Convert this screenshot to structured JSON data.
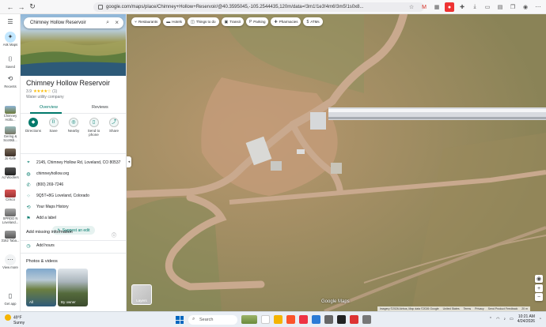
{
  "browser": {
    "url": "google.com/maps/place/Chimney+Hollow+Reservoir/@40.3595045,-105.2544435,120m/data=!3m1!1e3!4m6!3m5!1s0x8..."
  },
  "sidebar": {
    "items": [
      {
        "label": "Ask Maps",
        "icon": "sparkle-icon"
      },
      {
        "label": "Saved",
        "icon": "bookmark-icon"
      },
      {
        "label": "Recents",
        "icon": "history-icon"
      },
      {
        "label": "Chimney Hollo...",
        "icon": "place-thumb"
      },
      {
        "label": "Gering & Scottsb...",
        "icon": "place-thumb"
      },
      {
        "label": "Jo Kafe",
        "icon": "place-thumb"
      },
      {
        "label": "AJ Woofers",
        "icon": "place-thumb"
      },
      {
        "label": "Crisco",
        "icon": "place-thumb"
      },
      {
        "label": "SPRDD N Loveland...",
        "icon": "place-thumb"
      },
      {
        "label": "3162 Taba...",
        "icon": "place-thumb"
      },
      {
        "label": "View more",
        "icon": "more-icon"
      },
      {
        "label": "Get app",
        "icon": "phone-icon"
      }
    ]
  },
  "place": {
    "search_value": "Chimney Hollow Reservoir",
    "title": "Chimney Hollow Reservoir",
    "rating": "3.9",
    "stars": "★★★★☆",
    "review_count": "(1)",
    "category": "Water utility company",
    "tabs": [
      "Overview",
      "Reviews"
    ],
    "actions": [
      "Directions",
      "Save",
      "Nearby",
      "Send to phone",
      "Share"
    ],
    "info": [
      {
        "icon": "pin-icon",
        "text": "2145, Chimney Hollow Rd, Loveland, CO 80537"
      },
      {
        "icon": "globe-icon",
        "text": "chimneyhollow.org"
      },
      {
        "icon": "phone-icon",
        "text": "(800) 269-7246"
      },
      {
        "icon": "pluscode-icon",
        "text": "9Q5T+8G Loveland, Colorado"
      },
      {
        "icon": "history-icon",
        "text": "Your Maps History"
      },
      {
        "icon": "label-icon",
        "text": "Add a label"
      }
    ],
    "suggest_edit": "Suggest an edit",
    "missing_info_title": "Add missing information",
    "add_hours": "Add hours",
    "photos_title": "Photos & videos",
    "photo_labels": [
      "All",
      "By owner"
    ]
  },
  "map": {
    "chips": [
      {
        "icon": "fork-icon",
        "label": "Restaurants"
      },
      {
        "icon": "bed-icon",
        "label": "Hotels"
      },
      {
        "icon": "camera-icon",
        "label": "Things to do"
      },
      {
        "icon": "bus-icon",
        "label": "Transit"
      },
      {
        "icon": "parking-icon",
        "label": "Parking"
      },
      {
        "icon": "pill-icon",
        "label": "Pharmacies"
      },
      {
        "icon": "atm-icon",
        "label": "ATMs"
      }
    ],
    "layers_label": "Layers",
    "logo": "Google Maps",
    "attribution": [
      "Imagery ©2026 Airbus, Map data ©2026 Google",
      "United States",
      "Terms",
      "Privacy",
      "Send Product Feedback",
      "20 m"
    ]
  },
  "taskbar": {
    "temp": "49°F",
    "condition": "Sunny",
    "search_placeholder": "Search",
    "time": "10:21 AM",
    "date": "4/24/2026"
  },
  "colors": {
    "accent": "#00796b",
    "star": "#fbbc04",
    "road": "#c9a98e"
  }
}
